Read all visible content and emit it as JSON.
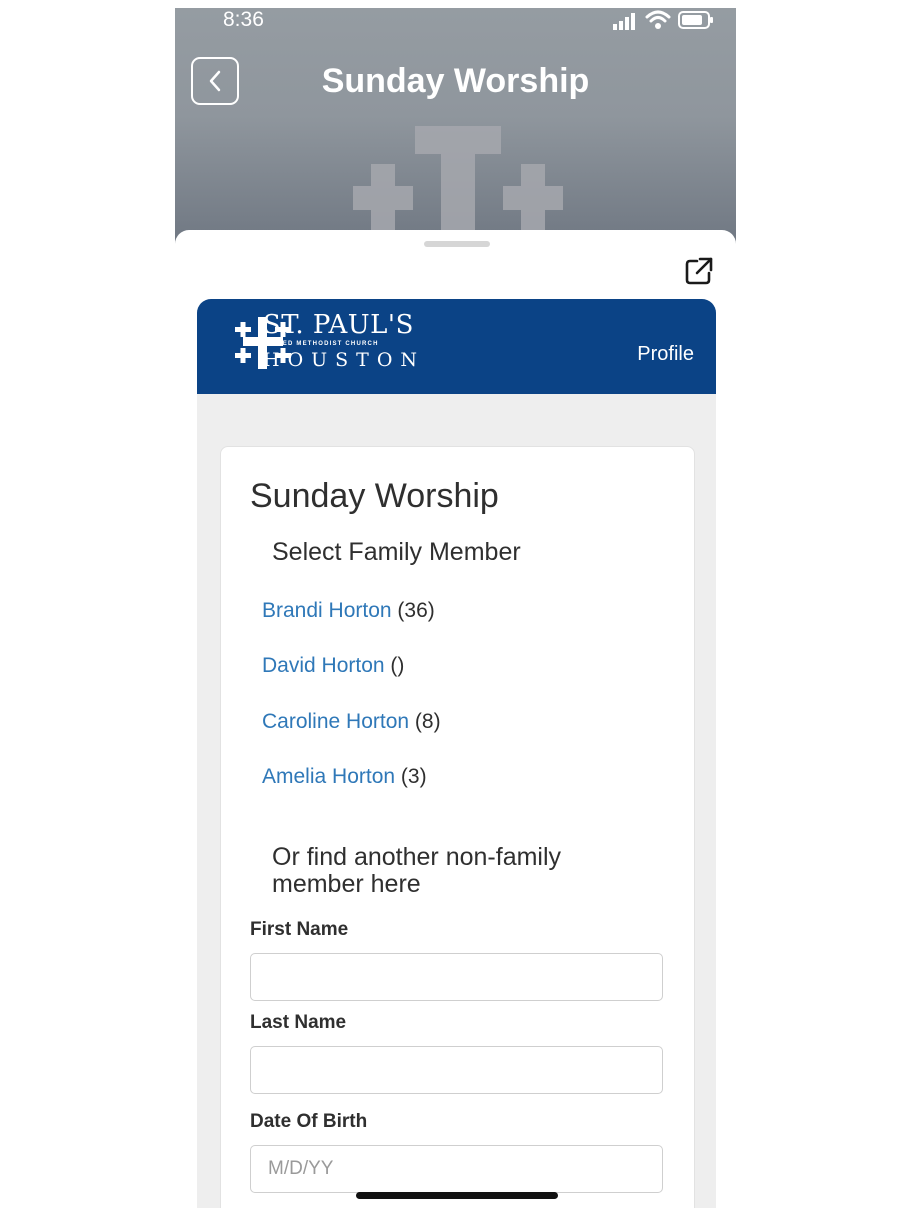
{
  "status_bar": {
    "time": "8:36"
  },
  "header": {
    "title": "Sunday Worship"
  },
  "church": {
    "name": "ST. PAUL'S",
    "subtitle": "UNITED METHODIST CHURCH",
    "city": "HOUSTON",
    "profile_label": "Profile",
    "brand_color": "#0b4386"
  },
  "card": {
    "title": "Sunday Worship",
    "select_heading": "Select Family Member",
    "family_members": [
      {
        "name": "Brandi Horton",
        "age": "(36)"
      },
      {
        "name": "David Horton",
        "age": "()"
      },
      {
        "name": "Caroline Horton",
        "age": "(8)"
      },
      {
        "name": "Amelia Horton",
        "age": "(3)"
      }
    ],
    "or_heading": "Or find another non-family member here",
    "fields": {
      "first_name": {
        "label": "First Name",
        "value": "",
        "placeholder": ""
      },
      "last_name": {
        "label": "Last Name",
        "value": "",
        "placeholder": ""
      },
      "dob": {
        "label": "Date Of Birth",
        "value": "",
        "placeholder": "M/D/YY"
      }
    }
  },
  "colors": {
    "link": "#2f78b8",
    "header_bg": "#8f969d"
  },
  "icons": [
    "back-icon",
    "signal-icon",
    "wifi-icon",
    "battery-icon",
    "external-link-icon",
    "church-cross-logo"
  ]
}
